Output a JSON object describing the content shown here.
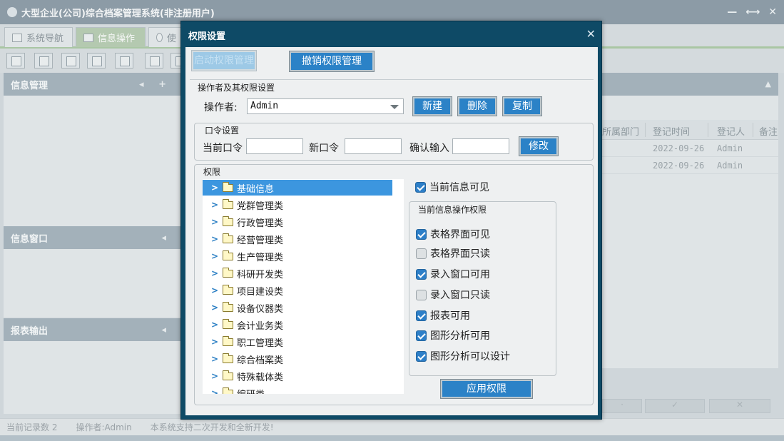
{
  "app": {
    "title": "大型企业(公司)综合档案管理系统(非注册用户)",
    "window_controls": [
      "—",
      "⟷",
      "✕"
    ]
  },
  "tabs": [
    {
      "label": "系统导航"
    },
    {
      "label": "信息操作"
    },
    {
      "label": "使"
    }
  ],
  "left_panels": [
    {
      "title": "信息管理",
      "icons": "◂ +"
    },
    {
      "title": "信息窗口",
      "icons": "◂"
    },
    {
      "title": "报表输出",
      "icons": "◂"
    }
  ],
  "grid": {
    "columns": [
      "所属部门",
      "登记时间",
      "登记人",
      "备注"
    ],
    "rows": [
      {
        "time": "2022-09-26",
        "user": "Admin"
      },
      {
        "time": "2022-09-26",
        "user": "Admin"
      }
    ]
  },
  "statusbar": {
    "records": "当前记录数 2",
    "operator": "操作者:Admin",
    "notice": "本系统支持二次开发和全新开发!"
  },
  "dialog": {
    "title": "权限设置",
    "close": "✕",
    "enable_btn": "启动权限管理",
    "disable_btn": "撤销权限管理",
    "operator_group": {
      "label": "操作者及其权限设置",
      "operator_label": "操作者:",
      "operator_value": "Admin",
      "new_btn": "新建",
      "delete_btn": "删除",
      "copy_btn": "复制"
    },
    "password_group": {
      "label": "口令设置",
      "current_label": "当前口令",
      "new_label": "新口令",
      "confirm_label": "确认输入",
      "modify_btn": "修改"
    },
    "permission_group": {
      "label": "权限",
      "tree": [
        {
          "label": "基础信息",
          "selected": true
        },
        {
          "label": "党群管理类"
        },
        {
          "label": "行政管理类"
        },
        {
          "label": "经营管理类"
        },
        {
          "label": "生产管理类"
        },
        {
          "label": "科研开发类"
        },
        {
          "label": "项目建设类"
        },
        {
          "label": "设备仪器类"
        },
        {
          "label": "会计业务类"
        },
        {
          "label": "职工管理类"
        },
        {
          "label": "综合档案类"
        },
        {
          "label": "特殊载体类"
        },
        {
          "label": "编研类"
        }
      ],
      "visible_label": "当前信息可见",
      "visible_checked": true,
      "ops_group_label": "当前信息操作权限",
      "ops": [
        {
          "label": "表格界面可见",
          "checked": true
        },
        {
          "label": "表格界面只读",
          "checked": false
        },
        {
          "label": "录入窗口可用",
          "checked": true
        },
        {
          "label": "录入窗口只读",
          "checked": false
        },
        {
          "label": "报表可用",
          "checked": true
        },
        {
          "label": "图形分析可用",
          "checked": true
        },
        {
          "label": "图形分析可以设计",
          "checked": true
        }
      ],
      "apply_btn": "应用权限"
    }
  },
  "colors": {
    "dialog_frame": "#0e4a66",
    "button_blue": "#2b82c7",
    "tree_selected": "#3c96df",
    "checkbox_on": "#2d7fc8"
  }
}
